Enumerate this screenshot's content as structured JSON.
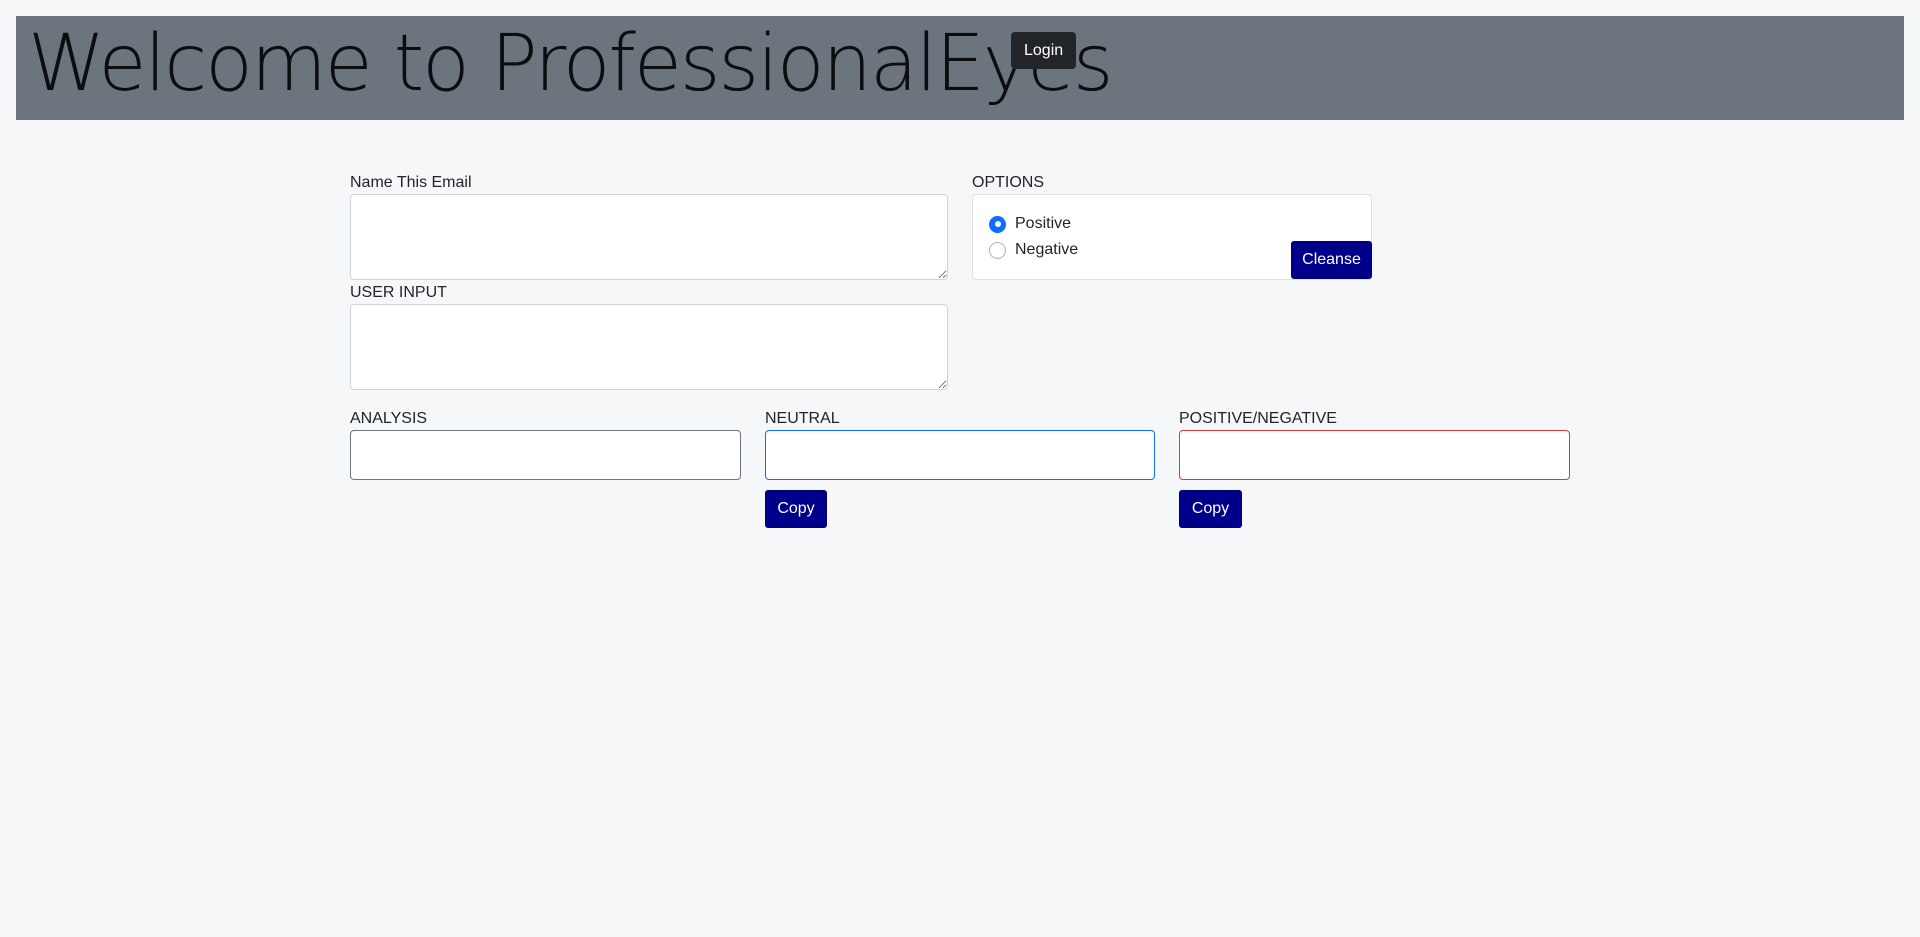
{
  "header": {
    "title": "Welcome to ProfessionalEyes",
    "login_label": "Login"
  },
  "form": {
    "name_email": {
      "label": "Name This Email",
      "value": "",
      "placeholder": ""
    },
    "user_input": {
      "label": "USER INPUT",
      "value": "",
      "placeholder": ""
    },
    "options": {
      "label": "OPTIONS",
      "items": [
        {
          "label": "Positive",
          "checked": true
        },
        {
          "label": "Negative",
          "checked": false
        }
      ],
      "cleanse_label": "Cleanse"
    },
    "analysis": {
      "label": "ANALYSIS",
      "value": "",
      "border_color": "#6c757d"
    },
    "neutral": {
      "label": "NEUTRAL",
      "value": "",
      "border_color": "#0d6efd",
      "copy_label": "Copy"
    },
    "posneg": {
      "label": "POSITIVE/NEGATIVE",
      "value": "",
      "border_color": "#dc3545",
      "copy_label": "Copy"
    }
  },
  "colors": {
    "header_bg": "#6c757d",
    "page_bg": "#f6f7f9",
    "button_navy": "#00008b",
    "radio_checked": "#0d6efd"
  }
}
